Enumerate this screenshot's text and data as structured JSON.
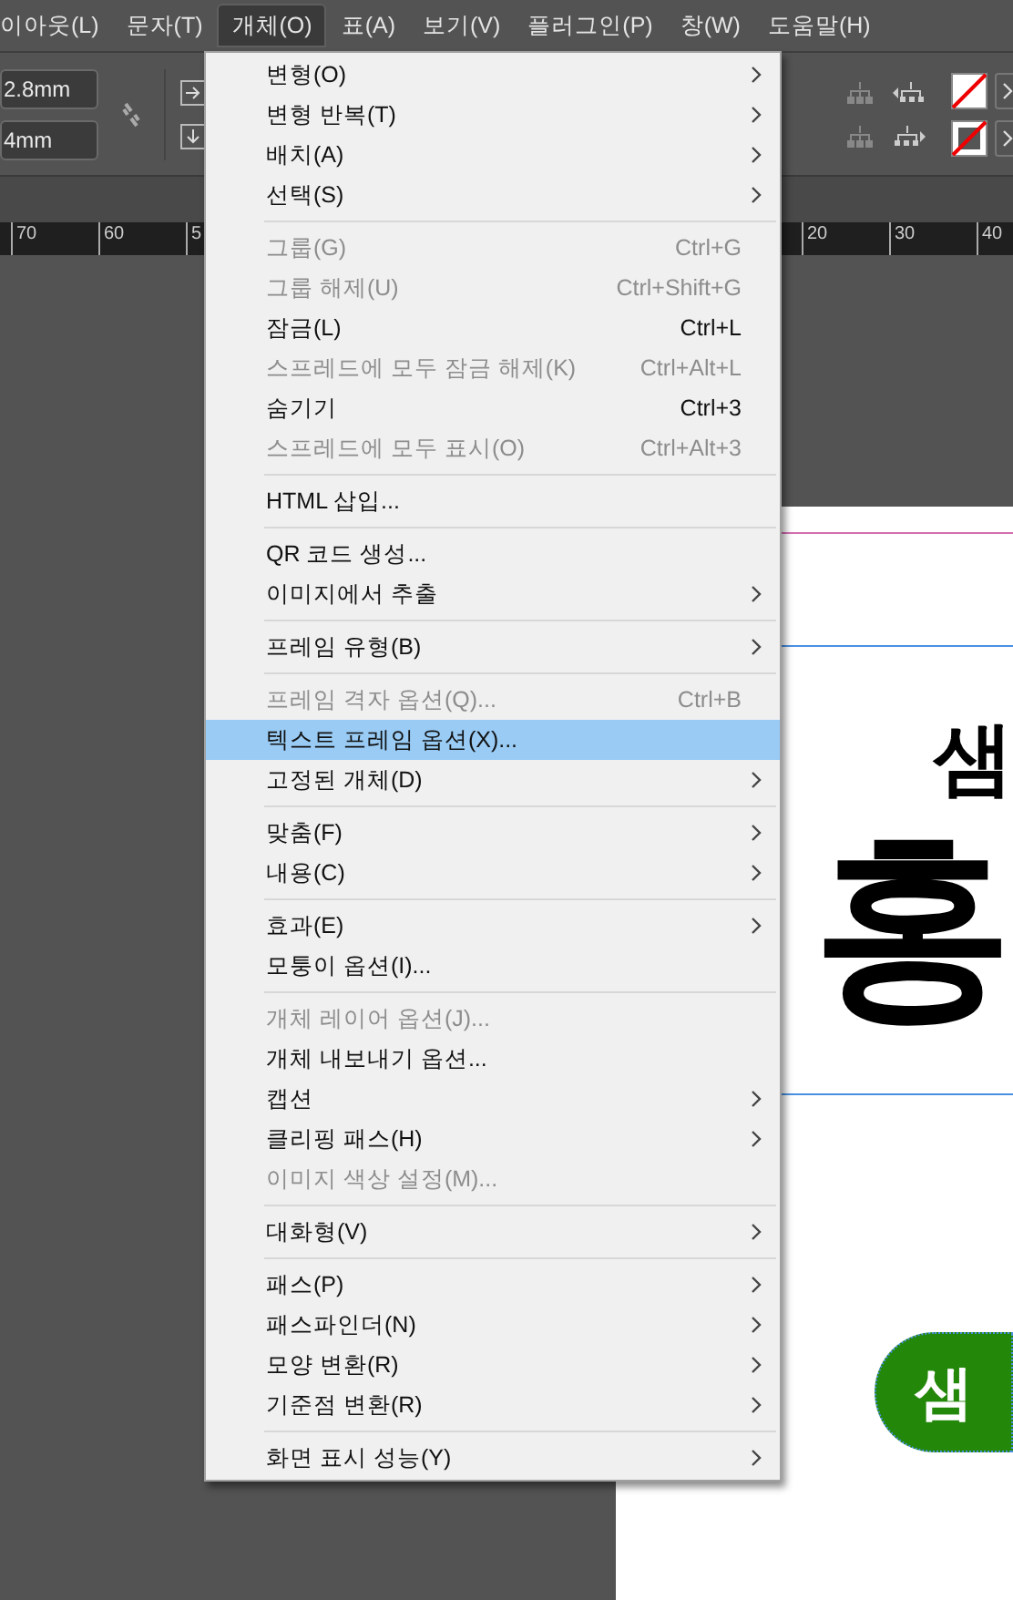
{
  "menu_bar": [
    {
      "label": "이아웃(L)",
      "selected": false
    },
    {
      "label": "문자(T)",
      "selected": false
    },
    {
      "label": "개체(O)",
      "selected": true
    },
    {
      "label": "표(A)",
      "selected": false
    },
    {
      "label": "보기(V)",
      "selected": false
    },
    {
      "label": "플러그인(P)",
      "selected": false
    },
    {
      "label": "창(W)",
      "selected": false
    },
    {
      "label": "도움말(H)",
      "selected": false
    }
  ],
  "toolbar": {
    "fields": [
      "2.8mm",
      "4mm"
    ]
  },
  "ruler": {
    "left_labels": [
      "70",
      "60",
      "5"
    ],
    "right_labels": [
      "20",
      "30",
      "40"
    ]
  },
  "menu": {
    "items": [
      {
        "kind": "item",
        "label": "변형(O)",
        "submenu": true,
        "disabled": false,
        "selected": false
      },
      {
        "kind": "item",
        "label": "변형 반복(T)",
        "submenu": true,
        "disabled": false,
        "selected": false
      },
      {
        "kind": "item",
        "label": "배치(A)",
        "submenu": true,
        "disabled": false,
        "selected": false
      },
      {
        "kind": "item",
        "label": "선택(S)",
        "submenu": true,
        "disabled": false,
        "selected": false
      },
      {
        "kind": "separator"
      },
      {
        "kind": "item",
        "label": "그룹(G)",
        "shortcut": "Ctrl+G",
        "submenu": false,
        "disabled": true,
        "selected": false
      },
      {
        "kind": "item",
        "label": "그룹 해제(U)",
        "shortcut": "Ctrl+Shift+G",
        "submenu": false,
        "disabled": true,
        "selected": false
      },
      {
        "kind": "item",
        "label": "잠금(L)",
        "shortcut": "Ctrl+L",
        "submenu": false,
        "disabled": false,
        "selected": false
      },
      {
        "kind": "item",
        "label": "스프레드에 모두 잠금 해제(K)",
        "shortcut": "Ctrl+Alt+L",
        "submenu": false,
        "disabled": true,
        "selected": false
      },
      {
        "kind": "item",
        "label": "숨기기",
        "shortcut": "Ctrl+3",
        "submenu": false,
        "disabled": false,
        "selected": false
      },
      {
        "kind": "item",
        "label": "스프레드에 모두 표시(O)",
        "shortcut": "Ctrl+Alt+3",
        "submenu": false,
        "disabled": true,
        "selected": false
      },
      {
        "kind": "separator"
      },
      {
        "kind": "item",
        "label": "HTML 삽입...",
        "submenu": false,
        "disabled": false,
        "selected": false
      },
      {
        "kind": "separator"
      },
      {
        "kind": "item",
        "label": "QR 코드 생성...",
        "submenu": false,
        "disabled": false,
        "selected": false
      },
      {
        "kind": "item",
        "label": "이미지에서 추출",
        "submenu": true,
        "disabled": false,
        "selected": false
      },
      {
        "kind": "separator"
      },
      {
        "kind": "item",
        "label": "프레임 유형(B)",
        "submenu": true,
        "disabled": false,
        "selected": false
      },
      {
        "kind": "separator"
      },
      {
        "kind": "item",
        "label": "프레임 격자 옵션(Q)...",
        "shortcut": "Ctrl+B",
        "submenu": false,
        "disabled": true,
        "selected": false
      },
      {
        "kind": "item",
        "label": "텍스트 프레임 옵션(X)...",
        "submenu": false,
        "disabled": false,
        "selected": true
      },
      {
        "kind": "item",
        "label": "고정된 개체(D)",
        "submenu": true,
        "disabled": false,
        "selected": false
      },
      {
        "kind": "separator"
      },
      {
        "kind": "item",
        "label": "맞춤(F)",
        "submenu": true,
        "disabled": false,
        "selected": false
      },
      {
        "kind": "item",
        "label": "내용(C)",
        "submenu": true,
        "disabled": false,
        "selected": false
      },
      {
        "kind": "separator"
      },
      {
        "kind": "item",
        "label": "효과(E)",
        "submenu": true,
        "disabled": false,
        "selected": false
      },
      {
        "kind": "item",
        "label": "모퉁이 옵션(I)...",
        "submenu": false,
        "disabled": false,
        "selected": false
      },
      {
        "kind": "separator"
      },
      {
        "kind": "item",
        "label": "개체 레이어 옵션(J)...",
        "submenu": false,
        "disabled": true,
        "selected": false
      },
      {
        "kind": "item",
        "label": "개체 내보내기 옵션...",
        "submenu": false,
        "disabled": false,
        "selected": false
      },
      {
        "kind": "item",
        "label": "캡션",
        "submenu": true,
        "disabled": false,
        "selected": false
      },
      {
        "kind": "item",
        "label": "클리핑 패스(H)",
        "submenu": true,
        "disabled": false,
        "selected": false
      },
      {
        "kind": "item",
        "label": "이미지 색상 설정(M)...",
        "submenu": false,
        "disabled": true,
        "selected": false
      },
      {
        "kind": "separator"
      },
      {
        "kind": "item",
        "label": "대화형(V)",
        "submenu": true,
        "disabled": false,
        "selected": false
      },
      {
        "kind": "separator"
      },
      {
        "kind": "item",
        "label": "패스(P)",
        "submenu": true,
        "disabled": false,
        "selected": false
      },
      {
        "kind": "item",
        "label": "패스파인더(N)",
        "submenu": true,
        "disabled": false,
        "selected": false
      },
      {
        "kind": "item",
        "label": "모양 변환(R)",
        "submenu": true,
        "disabled": false,
        "selected": false
      },
      {
        "kind": "item",
        "label": "기준점 변환(R)",
        "submenu": true,
        "disabled": false,
        "selected": false
      },
      {
        "kind": "separator"
      },
      {
        "kind": "item",
        "label": "화면 표시 성능(Y)",
        "submenu": true,
        "disabled": false,
        "selected": false
      }
    ]
  },
  "document": {
    "headline": "샘",
    "title": "홍",
    "logo_text": "샘"
  }
}
